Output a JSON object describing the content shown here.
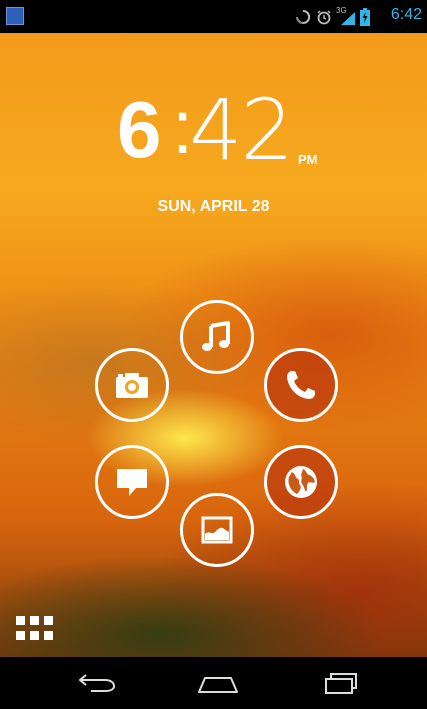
{
  "status_bar": {
    "time": "6:42",
    "network_type": "3G",
    "accent_color": "#33b5e5",
    "icons": [
      "notification-icon",
      "sync-icon",
      "alarm-icon",
      "signal-icon",
      "battery-icon"
    ]
  },
  "lockscreen": {
    "clock": {
      "hour": "6",
      "separator": ":",
      "minutes": "42",
      "am_pm": "PM"
    },
    "date": "SUN, APRIL 28",
    "ring_targets": [
      "music-icon",
      "phone-icon",
      "browser-icon",
      "gallery-icon",
      "messaging-icon",
      "camera-icon"
    ]
  },
  "nav_bar": {
    "buttons": [
      "back-icon",
      "home-icon",
      "recents-icon"
    ]
  }
}
